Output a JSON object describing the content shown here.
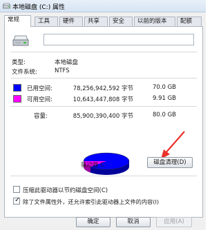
{
  "window": {
    "title": "本地磁盘 (C:) 属性"
  },
  "tabs": [
    {
      "label": "常规",
      "active": true
    },
    {
      "label": "工具",
      "active": false
    },
    {
      "label": "硬件",
      "active": false
    },
    {
      "label": "共享",
      "active": false
    },
    {
      "label": "安全",
      "active": false
    },
    {
      "label": "以前的版本",
      "active": false
    },
    {
      "label": "配额",
      "active": false
    }
  ],
  "general": {
    "drive_name": "",
    "type_label": "类型:",
    "type_value": "本地磁盘",
    "fs_label": "文件系统:",
    "fs_value": "NTFS",
    "used_label": "已用空间:",
    "used_bytes": "78,256,942,592 字节",
    "used_size": "70.0 GB",
    "free_label": "可用空间:",
    "free_bytes": "10,643,447,808 字节",
    "free_size": "9.91 GB",
    "capacity_label": "容量:",
    "capacity_bytes": "85,900,390,400 字节",
    "capacity_size": "80.0 GB",
    "drive_label": "驱动器 C:",
    "cleanup_button": "磁盘清理(D)",
    "compress_label": "压缩此驱动器以节约磁盘空间(C)",
    "compress_checked": false,
    "index_label": "除了文件属性外，还允许索引此驱动器上文件的内容(I)",
    "index_checked": true
  },
  "footer": {
    "ok": "确定",
    "cancel": "取消",
    "apply": "应用(A)"
  },
  "colors": {
    "used": "#0000ff",
    "free": "#ff00ff",
    "arrow": "#e8322a"
  },
  "icons": {
    "title": "drive-icon",
    "drive": "drive-icon",
    "arrow": "annotation-arrow"
  }
}
